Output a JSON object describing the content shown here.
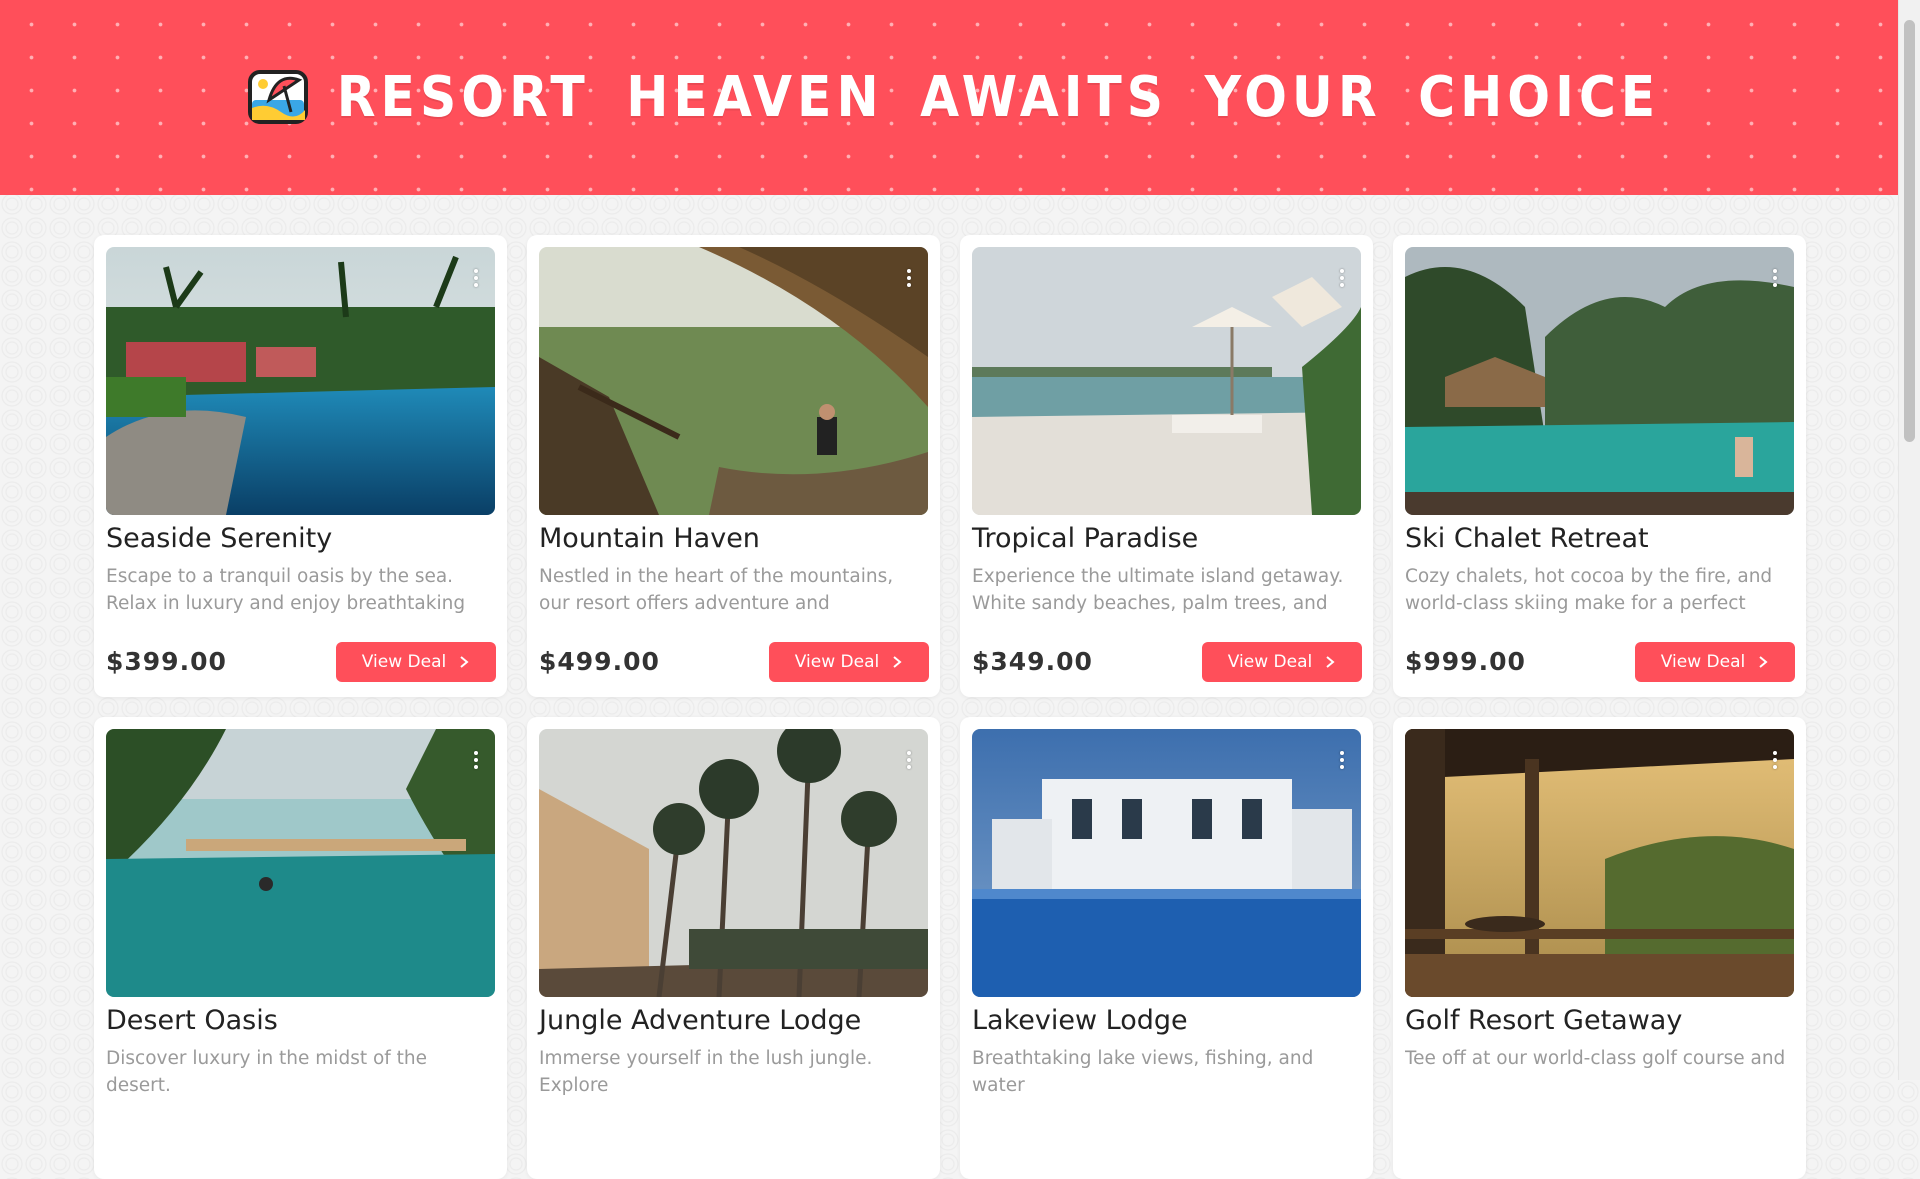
{
  "header": {
    "title": "RESORT HEAVEN AWAITS YOUR CHOICE",
    "logo_icon": "beach-umbrella-icon"
  },
  "colors": {
    "accent": "#ff4f5a",
    "card_bg": "#ffffff",
    "price": "#333333",
    "desc": "#9a9a9a"
  },
  "cards": [
    {
      "title": "Seaside Serenity",
      "desc": "Escape to a tranquil oasis by the sea. Relax in luxury and enjoy breathtaking ocean",
      "price": "$399.00",
      "button": "View Deal",
      "image": "resort-pool-palms-photo"
    },
    {
      "title": "Mountain Haven",
      "desc": "Nestled in the heart of the mountains, our resort offers adventure and relaxation in",
      "price": "$499.00",
      "button": "View Deal",
      "image": "mountain-hammock-photo"
    },
    {
      "title": "Tropical Paradise",
      "desc": "Experience the ultimate island getaway. White sandy beaches, palm trees, and",
      "price": "$349.00",
      "button": "View Deal",
      "image": "beach-infinity-pool-photo"
    },
    {
      "title": "Ski Chalet Retreat",
      "desc": "Cozy chalets, hot cocoa by the fire, and world-class skiing make for a perfect",
      "price": "$999.00",
      "button": "View Deal",
      "image": "jungle-lagoon-pool-photo"
    },
    {
      "title": "Desert Oasis",
      "desc": "Discover luxury in the midst of the desert.",
      "price": "",
      "button": "",
      "image": "infinity-pool-swimmer-photo"
    },
    {
      "title": "Jungle Adventure Lodge",
      "desc": "Immerse yourself in the lush jungle. Explore",
      "price": "",
      "button": "",
      "image": "palm-hotel-photo"
    },
    {
      "title": "Lakeview Lodge",
      "desc": "Breathtaking lake views, fishing, and water",
      "price": "",
      "button": "",
      "image": "night-pool-villa-photo"
    },
    {
      "title": "Golf Resort Getaway",
      "desc": "Tee off at our world-class golf course and",
      "price": "",
      "button": "",
      "image": "balcony-sunset-photo"
    }
  ]
}
